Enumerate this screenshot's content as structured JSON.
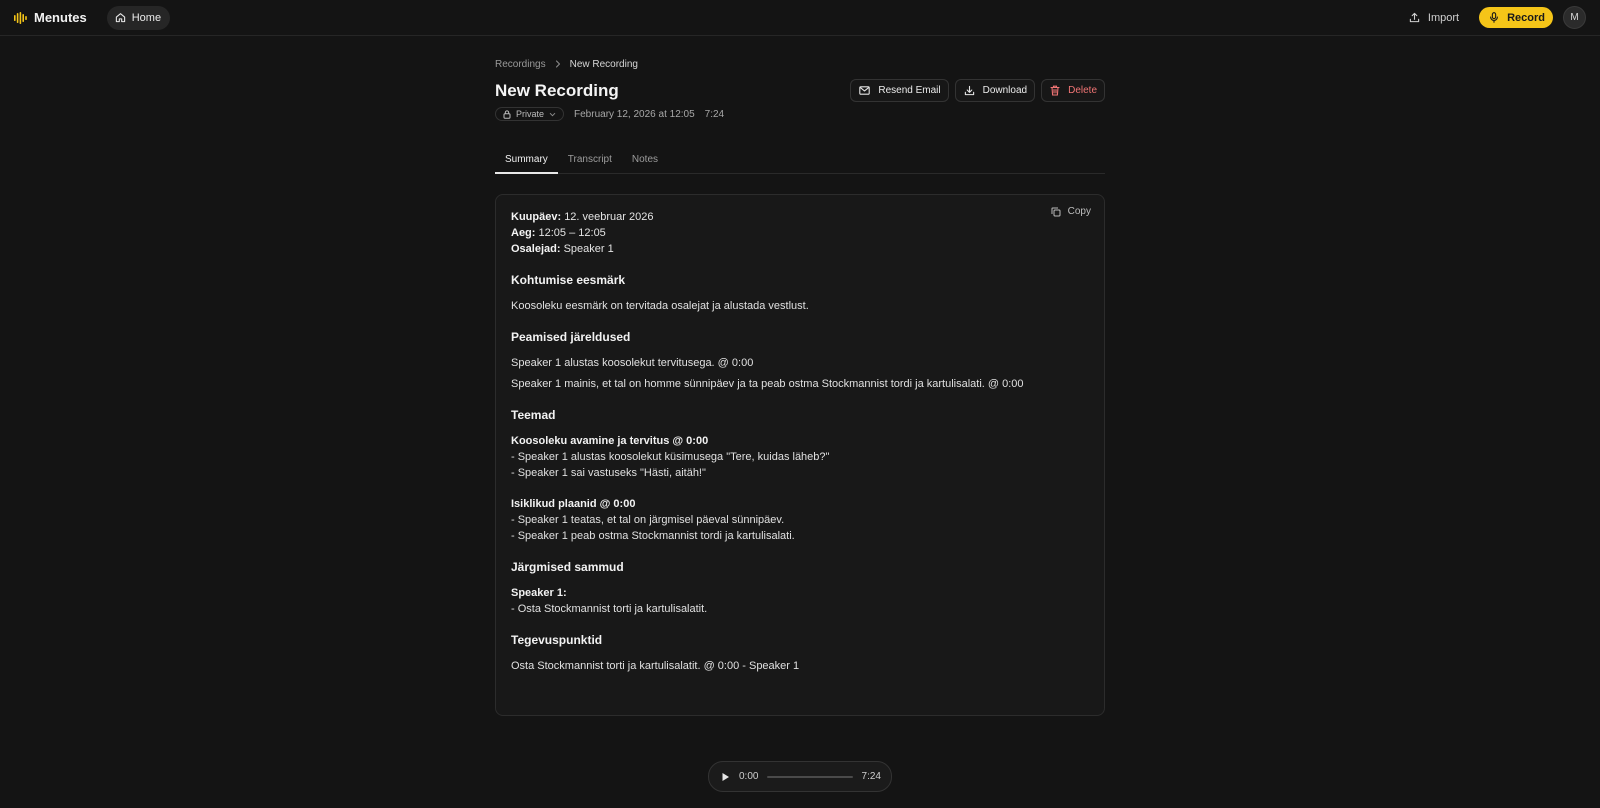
{
  "app": {
    "name": "Menutes",
    "home_label": "Home"
  },
  "topbar": {
    "import_label": "Import",
    "record_label": "Record",
    "avatar_initial": "M",
    "accent_color": "#f5c518"
  },
  "breadcrumb": {
    "parent": "Recordings",
    "current": "New Recording"
  },
  "recording": {
    "title": "New Recording",
    "privacy": "Private",
    "datetime": "February 12, 2026 at 12:05",
    "duration": "7:24"
  },
  "actions": {
    "resend_email": "Resend Email",
    "download": "Download",
    "delete": "Delete"
  },
  "tabs": [
    {
      "label": "Summary",
      "active": true
    },
    {
      "label": "Transcript",
      "active": false
    },
    {
      "label": "Notes",
      "active": false
    }
  ],
  "summary": {
    "copy_label": "Copy",
    "info": {
      "date_label": "Kuupäev:",
      "date_value": "12. veebruar 2026",
      "time_label": "Aeg:",
      "time_value": "12:05 – 12:05",
      "participants_label": "Osalejad:",
      "participants_value": "Speaker 1"
    },
    "purpose": {
      "heading": "Kohtumise eesmärk",
      "text": "Koosoleku eesmärk on tervitada osalejat ja alustada vestlust."
    },
    "conclusions": {
      "heading": "Peamised järeldused",
      "items": [
        "Speaker 1 alustas koosolekut tervitusega. @ 0:00",
        "Speaker 1 mainis, et tal on homme sünnipäev ja ta peab ostma Stockmannist tordi ja kartulisalati. @ 0:00"
      ]
    },
    "topics": {
      "heading": "Teemad",
      "groups": [
        {
          "title": "Koosoleku avamine ja tervitus @ 0:00",
          "lines": [
            "- Speaker 1 alustas koosolekut küsimusega \"Tere, kuidas läheb?\"",
            "- Speaker 1 sai vastuseks \"Hästi, aitäh!\""
          ]
        },
        {
          "title": "Isiklikud plaanid @ 0:00",
          "lines": [
            "- Speaker 1 teatas, et tal on järgmisel päeval sünnipäev.",
            "- Speaker 1 peab ostma Stockmannist tordi ja kartulisalati."
          ]
        }
      ]
    },
    "next_steps": {
      "heading": "Järgmised sammud",
      "owner": "Speaker 1:",
      "line": "- Osta Stockmannist torti ja kartulisalatit."
    },
    "action_items": {
      "heading": "Tegevuspunktid",
      "line": "Osta Stockmannist torti ja kartulisalatit. @ 0:00 - Speaker 1"
    }
  },
  "player": {
    "current": "0:00",
    "total": "7:24",
    "progress": 0
  }
}
